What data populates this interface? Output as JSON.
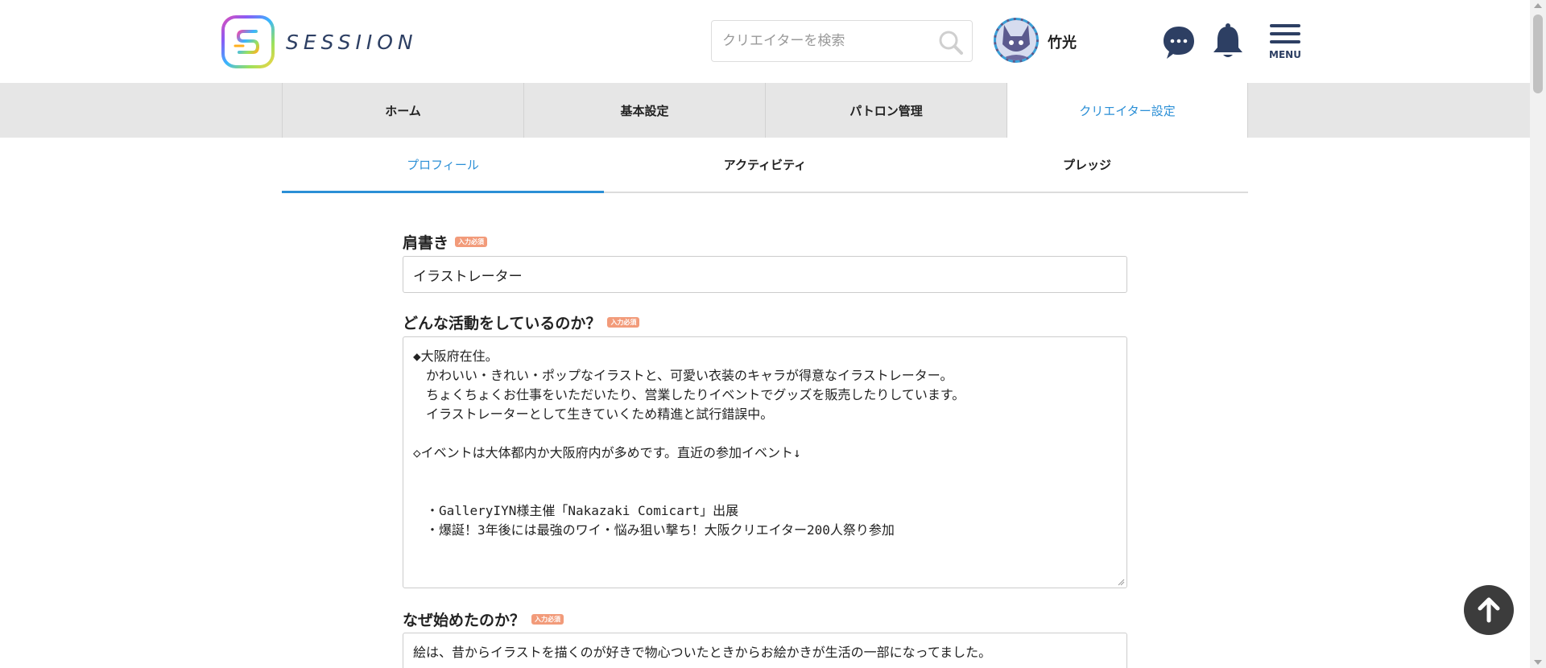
{
  "header": {
    "logo_text": "SESSIION",
    "search_placeholder": "クリエイターを検索",
    "username": "竹光",
    "menu_label": "MENU"
  },
  "main_tabs": [
    {
      "label": "ホーム"
    },
    {
      "label": "基本設定"
    },
    {
      "label": "パトロン管理"
    },
    {
      "label": "クリエイター設定",
      "active": true
    }
  ],
  "sub_tabs": [
    {
      "label": "プロフィール",
      "active": true
    },
    {
      "label": "アクティビティ"
    },
    {
      "label": "プレッジ"
    }
  ],
  "form": {
    "required_badge": "入力必須",
    "title_field": {
      "label": "肩書き",
      "value": "イラストレーター"
    },
    "activity_field": {
      "label": "どんな活動をしているのか？",
      "lines": [
        "◆大阪府在住。",
        "　かわいい・きれい・ポップなイラストと、可愛い衣装のキャラが得意なイラストレーター。",
        "　ちょくちょくお仕事をいただいたり、営業したりイベントでグッズを販売したりしています。",
        "　イラストレーターとして生きていくため精進と試行錯誤中。",
        "",
        "◇イベントは大体都内か大阪府内が多めです。直近の参加イベント↓",
        "",
        "",
        "　・GalleryIYN様主催「Nakazaki Comicart」出展",
        "　・爆誕！3年後には最強のワイ・悩み狙い撃ち！大阪クリエイター200人祭り参加"
      ]
    },
    "reason_field": {
      "label": "なぜ始めたのか？",
      "lines": [
        "絵は、昔からイラストを描くのが好きで物心ついたときからお絵かきが生活の一部になってました。"
      ]
    }
  },
  "colors": {
    "accent": "#2b8fd6",
    "navy": "#2d3f63",
    "badge": "#f29b7a",
    "tab_bg": "#e6e6e6"
  },
  "icons": [
    "search-icon",
    "chat-icon",
    "bell-icon",
    "menu-icon",
    "arrow-up-icon"
  ]
}
